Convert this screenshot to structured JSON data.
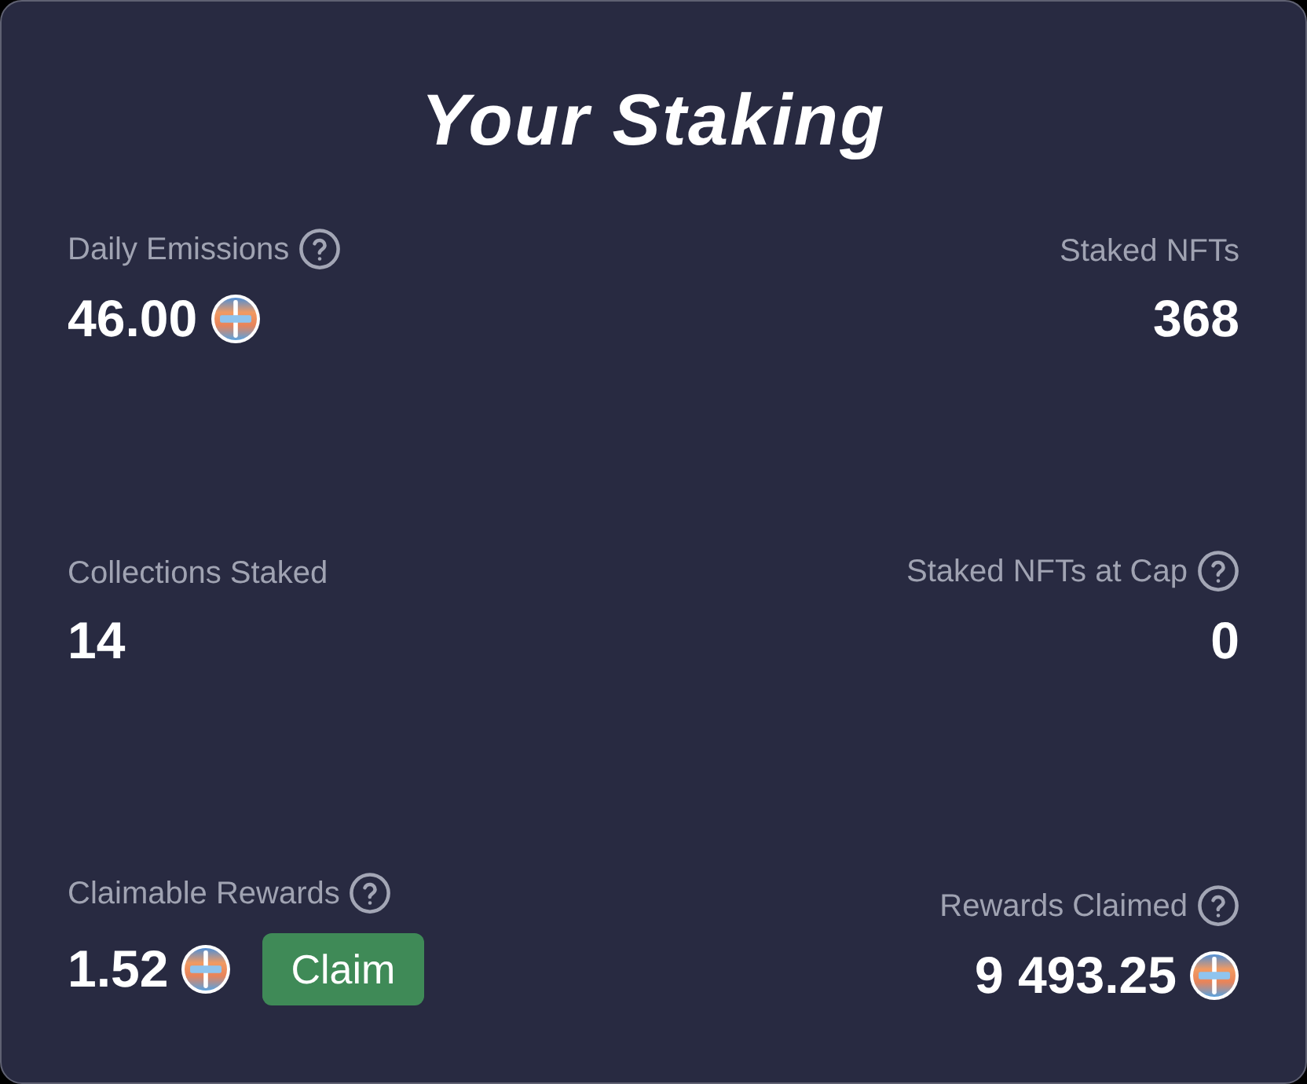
{
  "card": {
    "title": "Your Staking"
  },
  "stats": [
    {
      "label": "Daily Emissions",
      "help": true,
      "value": "46.00",
      "coin": true
    },
    {
      "label": "Staked NFTs",
      "help": false,
      "value": "368",
      "coin": false
    },
    {
      "label": "Collections Staked",
      "help": false,
      "value": "14",
      "coin": false
    },
    {
      "label": "Staked NFTs at Cap",
      "help": true,
      "value": "0",
      "coin": false
    },
    {
      "label": "Claimable Rewards",
      "help": true,
      "value": "1.52",
      "coin": true,
      "action": "Claim"
    },
    {
      "label": "Rewards Claimed",
      "help": true,
      "value": "9 493.25",
      "coin": true
    }
  ]
}
